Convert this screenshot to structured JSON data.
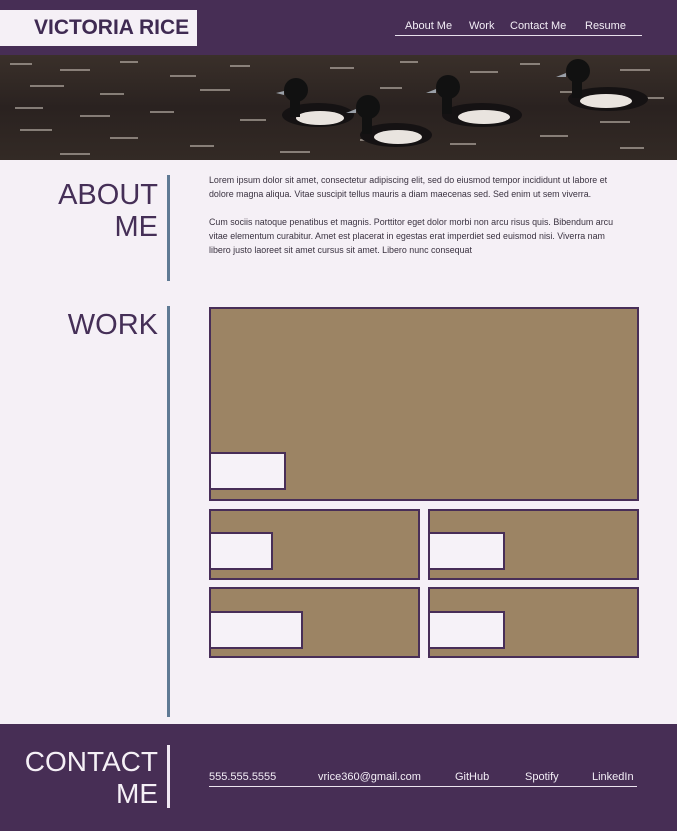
{
  "header": {
    "brand": "VICTORIA RICE",
    "nav": [
      "About Me",
      "Work",
      "Contact Me",
      "Resume"
    ]
  },
  "hero": {
    "image": "ducks-on-water-photo"
  },
  "about": {
    "title_line1": "ABOUT",
    "title_line2": "ME",
    "paragraph1": "Lorem ipsum dolor sit amet, consectetur adipiscing elit, sed do eiusmod tempor incididunt ut labore et dolore magna aliqua. Vitae suscipit tellus mauris a diam maecenas sed. Sed enim ut sem viverra.",
    "paragraph2": "Cum sociis natoque penatibus et magnis. Porttitor eget dolor morbi non arcu risus quis. Bibendum arcu vitae elementum curabitur. Amet est placerat in egestas erat imperdiet sed euismod nisi. Viverra nam libero justo laoreet sit amet cursus sit amet. Libero nunc consequat"
  },
  "work": {
    "title": "WORK",
    "card_color": "#9c8464"
  },
  "contact": {
    "title_line1": "CONTACT",
    "title_line2": "ME",
    "links": [
      "555.555.5555",
      "vrice360@gmail.com",
      "GitHub",
      "Spotify",
      "LinkedIn"
    ]
  },
  "colors": {
    "primary": "#472e55",
    "background": "#f5f0f6",
    "accent_line": "#5f7a94"
  }
}
